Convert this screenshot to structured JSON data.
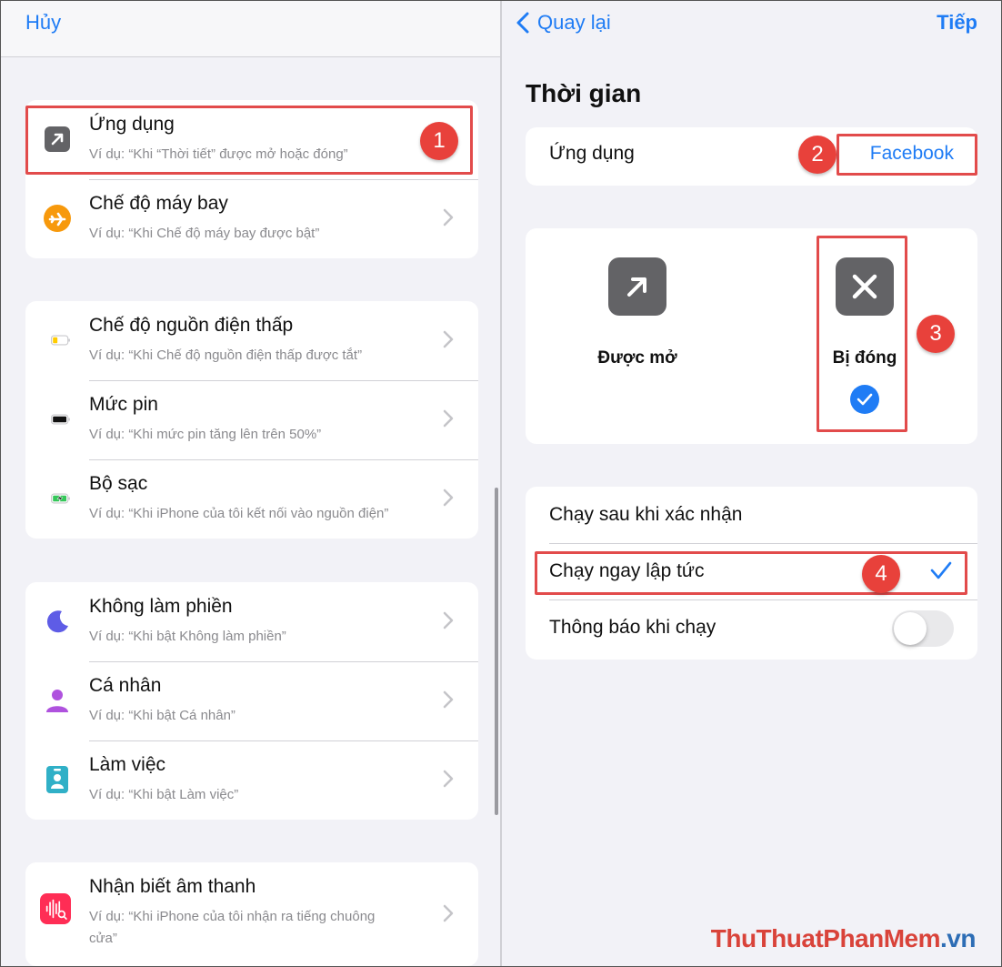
{
  "left": {
    "cancel_label": "Hủy",
    "groups": [
      {
        "items": [
          {
            "title": "Ứng dụng",
            "subtitle": "Ví dụ: “Khi “Thời tiết” được mở hoặc đóng”",
            "icon": "app-arrow-icon"
          },
          {
            "title": "Chế độ máy bay",
            "subtitle": "Ví dụ: “Khi Chế độ máy bay được bật”",
            "icon": "airplane-icon"
          }
        ]
      },
      {
        "items": [
          {
            "title": "Chế độ nguồn điện thấp",
            "subtitle": "Ví dụ: “Khi Chế độ nguồn điện thấp được tắt”",
            "icon": "low-battery-icon"
          },
          {
            "title": "Mức pin",
            "subtitle": "Ví dụ: “Khi mức pin tăng lên trên 50%”",
            "icon": "battery-icon"
          },
          {
            "title": "Bộ sạc",
            "subtitle": "Ví dụ: “Khi iPhone của tôi kết nối vào nguồn điện”",
            "icon": "charging-battery-icon"
          }
        ]
      },
      {
        "items": [
          {
            "title": "Không làm phiền",
            "subtitle": "Ví dụ: “Khi bật Không làm phiền”",
            "icon": "moon-icon"
          },
          {
            "title": "Cá nhân",
            "subtitle": "Ví dụ: “Khi bật Cá nhân”",
            "icon": "person-icon"
          },
          {
            "title": "Làm việc",
            "subtitle": "Ví dụ: “Khi bật Làm việc”",
            "icon": "id-badge-icon"
          }
        ]
      },
      {
        "items": [
          {
            "title": "Nhận biết âm thanh",
            "subtitle": "Ví dụ: “Khi iPhone của tôi nhận ra tiếng chuông cửa”",
            "icon": "sound-wave-icon"
          }
        ]
      }
    ]
  },
  "right": {
    "back_label": "Quay lại",
    "next_label": "Tiếp",
    "section_title": "Thời gian",
    "app_label": "Ứng dụng",
    "app_value": "Facebook",
    "choices": [
      {
        "label": "Được mở",
        "icon": "open-arrow-icon",
        "selected": false
      },
      {
        "label": "Bị đóng",
        "icon": "close-x-icon",
        "selected": true
      }
    ],
    "options": [
      {
        "label": "Chạy sau khi xác nhận",
        "selected": false
      },
      {
        "label": "Chạy ngay lập tức",
        "selected": true
      }
    ],
    "notify_label": "Thông báo khi chạy",
    "notify_on": false
  },
  "annotations": [
    "1",
    "2",
    "3",
    "4"
  ],
  "watermark": {
    "part1": "ThuThuat",
    "part2": "PhanMem",
    "part3": ".vn"
  },
  "colors": {
    "accent": "#1f7cf5",
    "annotation_red": "#e8413b",
    "background": "#f2f2f7"
  }
}
